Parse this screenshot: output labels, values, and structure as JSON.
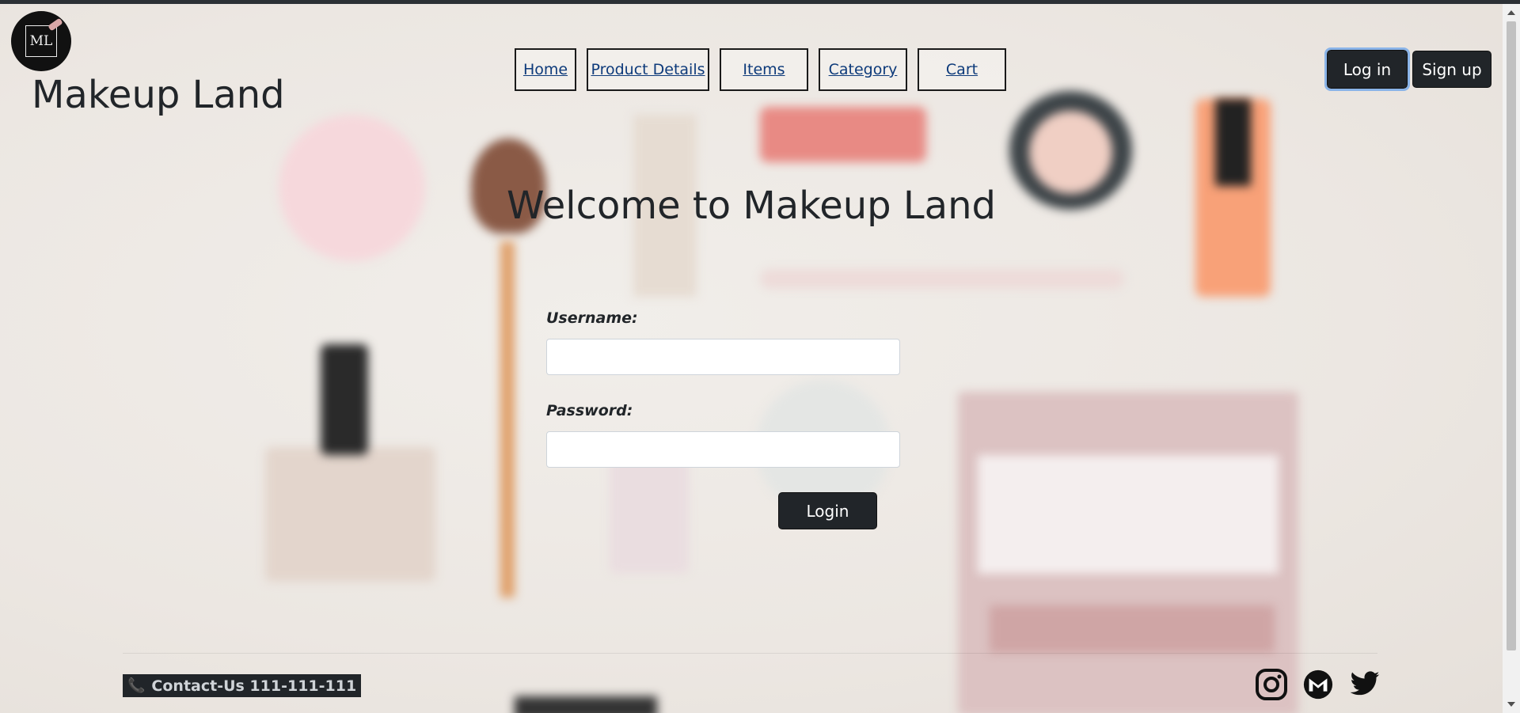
{
  "brand": {
    "logo_text": "ML",
    "site_title": "Makeup Land"
  },
  "nav": {
    "items": [
      {
        "label": "Home"
      },
      {
        "label": "Product Details"
      },
      {
        "label": "Items"
      },
      {
        "label": "Category"
      },
      {
        "label": "Cart"
      }
    ]
  },
  "auth": {
    "login_label": "Log in",
    "signup_label": "Sign up"
  },
  "main": {
    "heading": "Welcome to Makeup Land",
    "form": {
      "username_label": "Username:",
      "username_value": "",
      "password_label": "Password:",
      "password_value": "",
      "submit_label": "Login"
    }
  },
  "footer": {
    "contact_text": "Contact-Us 111-111-111",
    "social_icons": [
      "instagram-icon",
      "mail-icon",
      "twitter-icon"
    ]
  },
  "colors": {
    "dark": "#212529",
    "link": "#0d3a7a",
    "background": "#efebe7",
    "focus_outline": "#8ab4e8"
  }
}
